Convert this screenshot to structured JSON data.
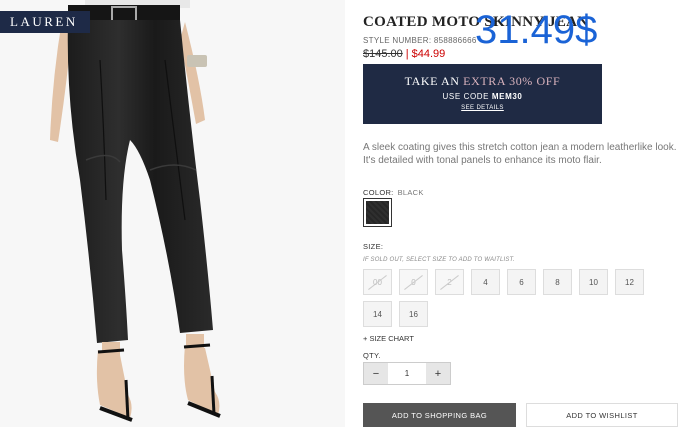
{
  "brand": "LAUREN",
  "product": {
    "title": "COATED MOTO SKINNY JEAN",
    "style_label": "STYLE NUMBER:",
    "style_number": "858886666",
    "price_old": "$145.00",
    "price_sep": "|",
    "price_new": "$44.99",
    "overlay_price": "31.49$",
    "description": "A sleek coating gives this stretch cotton jean a modern leatherlike look. It's detailed with tonal panels to enhance its moto flair."
  },
  "promo": {
    "line1_a": "TAKE AN",
    "line1_b": "EXTRA 30% OFF",
    "line2_a": "USE CODE",
    "code": "MEM30",
    "details": "SEE DETAILS"
  },
  "color": {
    "label": "COLOR:",
    "value": "BLACK"
  },
  "size": {
    "label": "SIZE:",
    "note": "IF SOLD OUT, SELECT SIZE TO ADD TO WAITLIST.",
    "options": [
      {
        "label": "00",
        "available": false
      },
      {
        "label": "0",
        "available": false
      },
      {
        "label": "2",
        "available": false
      },
      {
        "label": "4",
        "available": true
      },
      {
        "label": "6",
        "available": true
      },
      {
        "label": "8",
        "available": true
      },
      {
        "label": "10",
        "available": true
      },
      {
        "label": "12",
        "available": true
      },
      {
        "label": "14",
        "available": true
      },
      {
        "label": "16",
        "available": true
      }
    ],
    "chart_link": "+ SIZE CHART"
  },
  "qty": {
    "label": "QTY.",
    "minus": "−",
    "value": "1",
    "plus": "+"
  },
  "actions": {
    "add_to_bag": "ADD TO SHOPPING BAG",
    "add_to_wishlist": "ADD TO WISHLIST"
  },
  "colors": {
    "navy": "#1f2a44",
    "sale_red": "#cc0000",
    "overlay_blue": "#1a63d6"
  }
}
